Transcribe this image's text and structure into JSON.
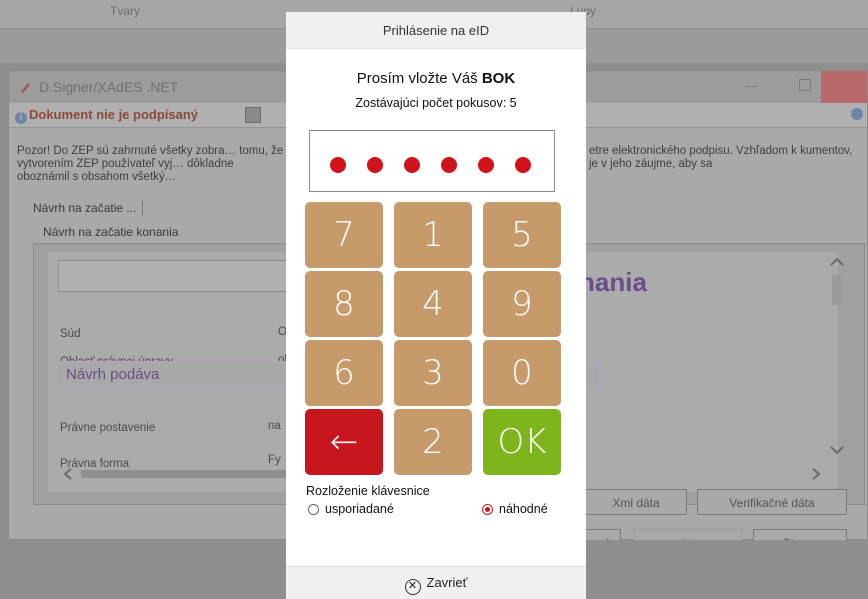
{
  "background": {
    "top_window": {
      "col1": "Tvary",
      "col2": "Lupy"
    },
    "signer_window": {
      "title": "D.Signer/XAdES .NET",
      "status": "Dokument nie je podpísaný",
      "warning_text": "Pozor! Do ZEP sú zahrnuté všetky zobra… tomu, že vytvorením ZEP používateľ vyj… dôkladne oboznámil s obsahom všetký…",
      "warning_text_right": "etre elektronického podpisu. Vzhľadom k kumentov, je v jeho záujme, aby sa",
      "tab_label": "Návrh na začatie ...",
      "subtab_label": "Návrh na začatie konania",
      "doc_heading": "e konania",
      "rows": [
        {
          "label": "Súd",
          "value": "O"
        },
        {
          "label": "Oblasť právnej úpravy",
          "value": "ob"
        }
      ],
      "section_title": "Návrh podáva",
      "rows2": [
        {
          "label": "Právne postavenie",
          "value": "na"
        },
        {
          "label": "Právna forma",
          "value": "Fy"
        }
      ],
      "buttons": {
        "xml": "Xml dáta",
        "verify": "Verifikačné dáta",
        "sign_partial": "ať",
        "ok": "OK",
        "cancel": "Storno"
      }
    }
  },
  "modal": {
    "title": "Prihlásenie na eID",
    "prompt_prefix": "Prosím vložte Váš ",
    "prompt_bold": "BOK",
    "attempts_label": "Zostávajúci počet pokusov:",
    "attempts_value": "5",
    "pin_length": 6,
    "keys": [
      [
        "7",
        "1",
        "5"
      ],
      [
        "8",
        "4",
        "9"
      ],
      [
        "6",
        "3",
        "0"
      ],
      [
        "←",
        "2",
        "OK"
      ]
    ],
    "layout_label": "Rozloženie klávesnice",
    "layout_options": [
      {
        "label": "usporiadané",
        "selected": false
      },
      {
        "label": "náhodné",
        "selected": true
      }
    ],
    "close_label": "Zavrieť"
  },
  "colors": {
    "key": "#c69a6a",
    "backspace": "#c8161e",
    "ok": "#7fb51c",
    "pin_dot": "#d1121b",
    "heading_purple": "#6a4d8a"
  }
}
